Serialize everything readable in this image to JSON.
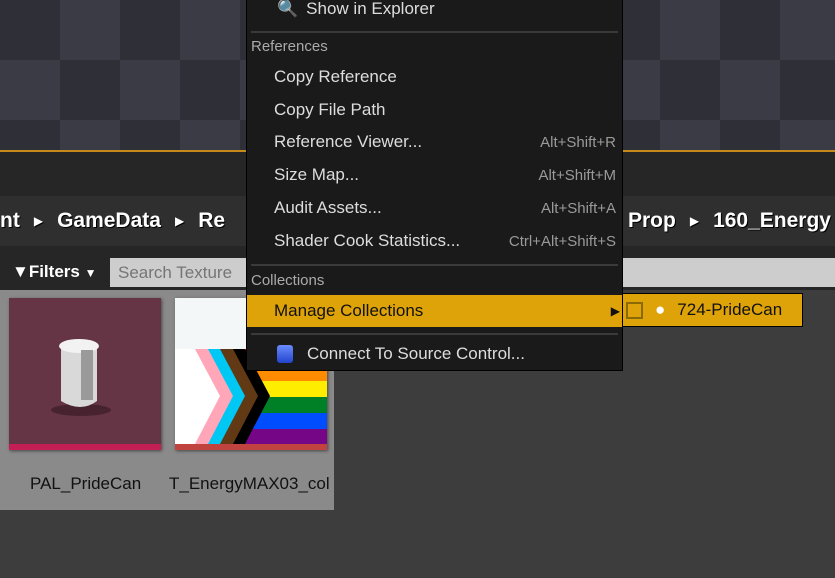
{
  "breadcrumb": [
    "nt",
    "GameData",
    "Re",
    "Prop",
    "160_Energy"
  ],
  "filters": {
    "label": "Filters",
    "search_placeholder": "Search Texture"
  },
  "assets": [
    {
      "name": "PAL_PrideCan"
    },
    {
      "name": "T_EnergyMAX03_col"
    }
  ],
  "menu": {
    "show_in_explorer": "Show in Explorer",
    "references_header": "References",
    "items": [
      {
        "label": "Copy Reference",
        "shortcut": ""
      },
      {
        "label": "Copy File Path",
        "shortcut": ""
      },
      {
        "label": "Reference Viewer...",
        "shortcut": "Alt+Shift+R"
      },
      {
        "label": "Size Map...",
        "shortcut": "Alt+Shift+M"
      },
      {
        "label": "Audit Assets...",
        "shortcut": "Alt+Shift+A"
      },
      {
        "label": "Shader Cook Statistics...",
        "shortcut": "Ctrl+Alt+Shift+S"
      }
    ],
    "collections_header": "Collections",
    "manage_collections": "Manage Collections",
    "connect_source_control": "Connect To Source Control..."
  },
  "submenu": {
    "collection": "724-PrideCan",
    "checked": false
  },
  "colors": {
    "highlight": "#dea308",
    "menu_bg": "#1a1a1a"
  }
}
